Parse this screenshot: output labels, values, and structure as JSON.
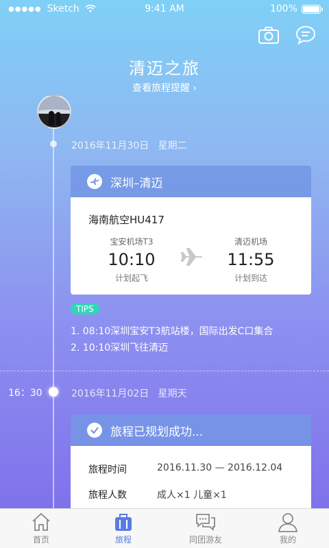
{
  "status_bar": {
    "signal": "●●●●●",
    "carrier": "Sketch",
    "time": "9:41 AM",
    "battery": "100%"
  },
  "header": {
    "title": "清迈之旅",
    "link": "查看旅程提醒 ›"
  },
  "timeline": [
    {
      "date": "2016年11月30日",
      "weekday": "星期二",
      "card": {
        "title": "深圳–清迈",
        "flight": "海南航空HU417",
        "departure": {
          "airport": "宝安机场T3",
          "time": "10:10",
          "note": "计划起飞"
        },
        "arrival": {
          "airport": "清迈机场",
          "time": "11:55",
          "note": "计划到达"
        }
      },
      "tips_label": "TIPS",
      "tips": [
        "1. 08:10深圳宝安T3航站楼，国际出发C口集合",
        "2. 10:10深圳飞往清迈"
      ]
    },
    {
      "time": "16：30",
      "date": "2016年11月02日",
      "weekday": "星期天",
      "card": {
        "title": "旅程已规划成功...",
        "rows": [
          {
            "label": "旅程时间",
            "value": "2016.11.30 — 2016.12.04"
          },
          {
            "label": "旅程人数",
            "value": "成人×1 儿童×1"
          }
        ]
      }
    }
  ],
  "tabbar": {
    "tabs": [
      {
        "label": "首页",
        "icon": "home-icon",
        "active": false
      },
      {
        "label": "旅程",
        "icon": "suitcase-icon",
        "active": true
      },
      {
        "label": "同团游友",
        "icon": "chat-bubbles-icon",
        "active": false
      },
      {
        "label": "我的",
        "icon": "user-icon",
        "active": false
      }
    ]
  },
  "colors": {
    "accent": "#5a7be3",
    "tips": "#31d7b6",
    "card_header": "#7397e4"
  }
}
